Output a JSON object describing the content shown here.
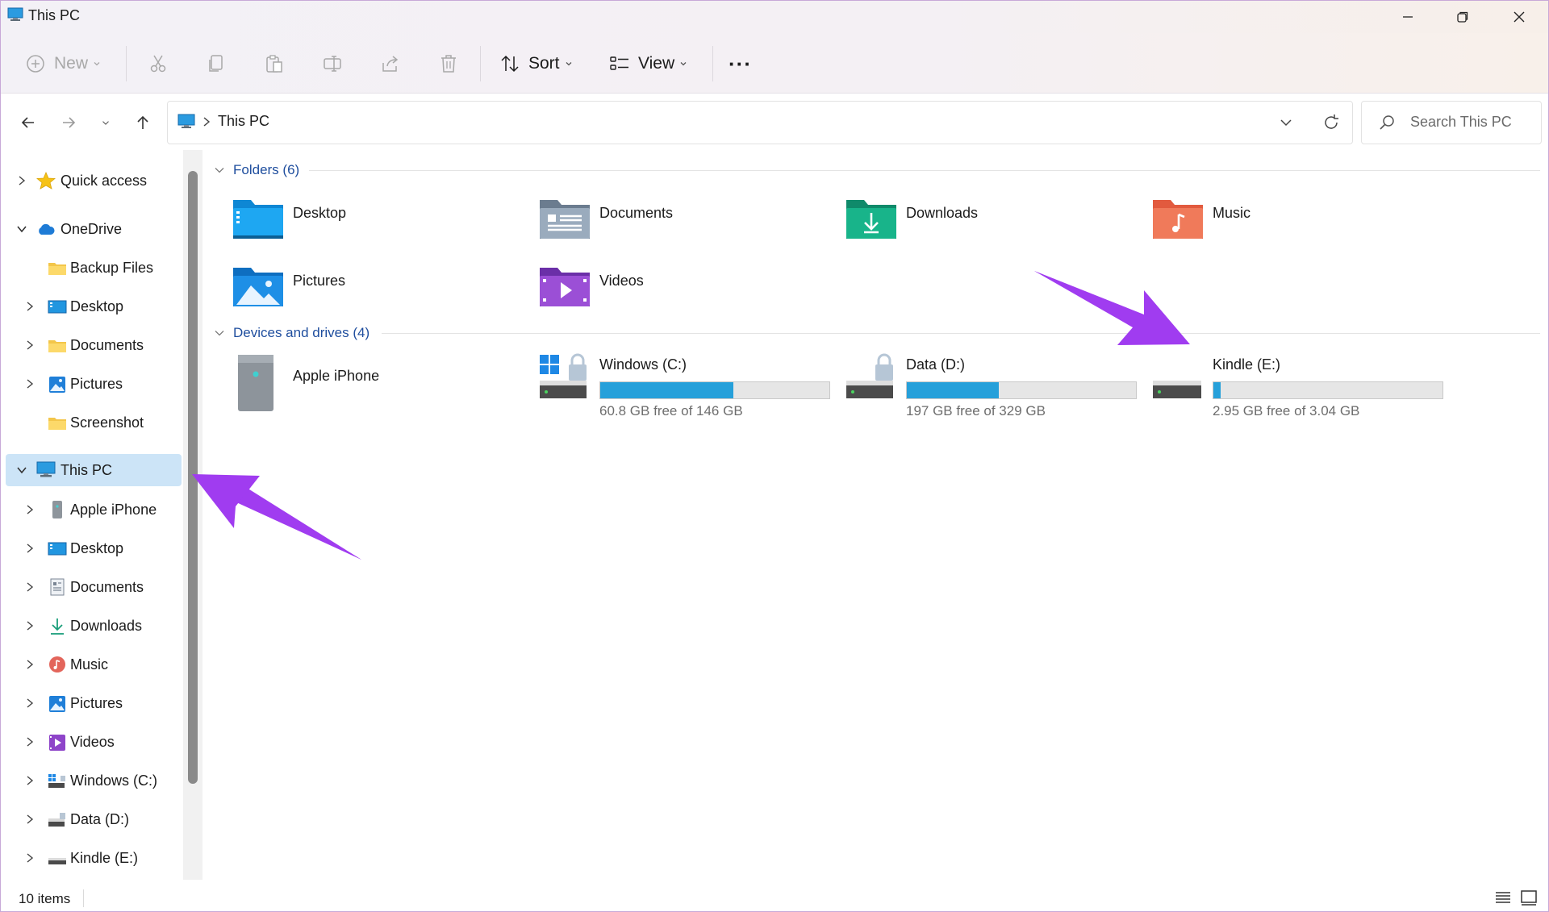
{
  "window": {
    "title": "This PC"
  },
  "toolbar": {
    "new_label": "New",
    "sort_label": "Sort",
    "view_label": "View",
    "more_label": "···"
  },
  "address": {
    "path": "This PC",
    "search_placeholder": "Search This PC"
  },
  "sidebar": {
    "items": [
      {
        "label": "Quick access",
        "icon": "star-icon"
      },
      {
        "label": "OneDrive",
        "icon": "cloud-icon"
      },
      {
        "label": "Backup Files",
        "icon": "folder-icon"
      },
      {
        "label": "Desktop",
        "icon": "desktop-icon"
      },
      {
        "label": "Documents",
        "icon": "folder-icon"
      },
      {
        "label": "Pictures",
        "icon": "pictures-icon"
      },
      {
        "label": "Screenshot",
        "icon": "folder-icon"
      },
      {
        "label": "This PC",
        "icon": "pc-icon"
      },
      {
        "label": "Apple iPhone",
        "icon": "phone-icon"
      },
      {
        "label": "Desktop",
        "icon": "desktop-icon"
      },
      {
        "label": "Documents",
        "icon": "documents-icon"
      },
      {
        "label": "Downloads",
        "icon": "download-icon"
      },
      {
        "label": "Music",
        "icon": "music-icon"
      },
      {
        "label": "Pictures",
        "icon": "pictures-icon"
      },
      {
        "label": "Videos",
        "icon": "videos-icon"
      },
      {
        "label": "Windows (C:)",
        "icon": "drive-icon"
      },
      {
        "label": "Data (D:)",
        "icon": "drive-icon"
      },
      {
        "label": "Kindle (E:)",
        "icon": "drive-icon"
      }
    ]
  },
  "main": {
    "folders_header": "Folders (6)",
    "folders": [
      {
        "label": "Desktop",
        "icon": "desktop-folder-icon"
      },
      {
        "label": "Documents",
        "icon": "documents-folder-icon"
      },
      {
        "label": "Downloads",
        "icon": "downloads-folder-icon"
      },
      {
        "label": "Music",
        "icon": "music-folder-icon"
      },
      {
        "label": "Pictures",
        "icon": "pictures-folder-icon"
      },
      {
        "label": "Videos",
        "icon": "videos-folder-icon"
      }
    ],
    "drives_header": "Devices and drives (4)",
    "devices": [
      {
        "label": "Apple iPhone",
        "icon": "iphone-device-icon"
      }
    ],
    "drives": [
      {
        "label": "Windows (C:)",
        "free": "60.8 GB free of 146 GB",
        "used_fraction": 0.58
      },
      {
        "label": "Data (D:)",
        "free": "197 GB free of 329 GB",
        "used_fraction": 0.4
      },
      {
        "label": "Kindle (E:)",
        "free": "2.95 GB free of 3.04 GB",
        "used_fraction": 0.03
      }
    ]
  },
  "status": {
    "items_count": "10 items"
  },
  "colors": {
    "accent": "#26a0da",
    "selection": "#cce4f7",
    "annotation_arrow": "#a03cf0",
    "group_header": "#1f4e9e"
  }
}
